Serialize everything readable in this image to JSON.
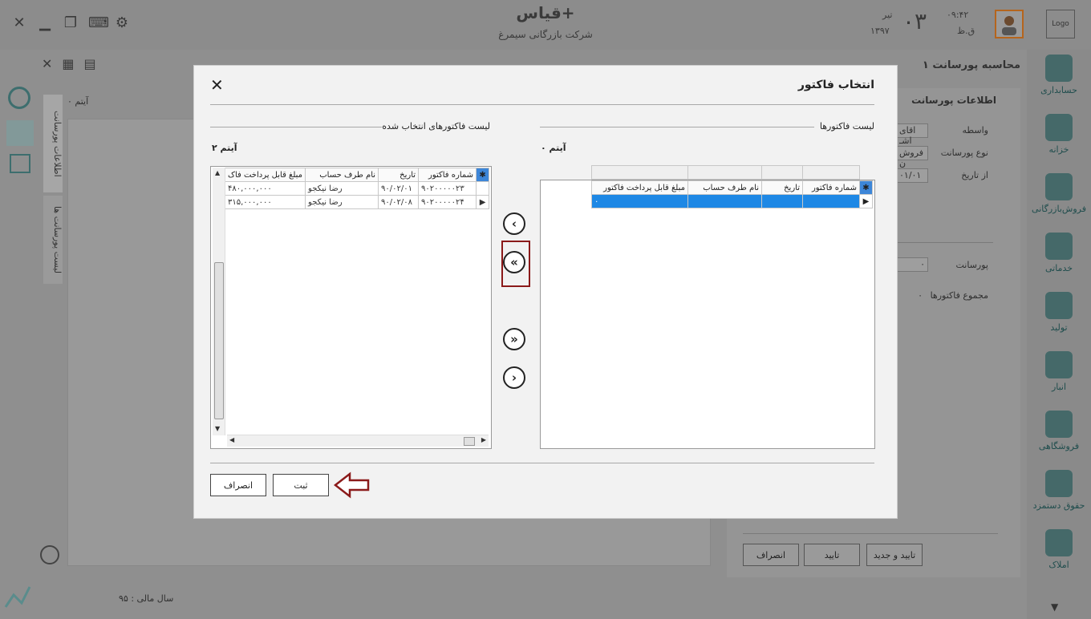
{
  "app": {
    "title": "قیاس+",
    "company": "شرکت بازرگانی سیمرغ",
    "date_day": "۰۳",
    "date_month": "تیر",
    "date_year": "۱۳۹۷",
    "time": "۰۹:۴۲",
    "ampm": "ق.ظ",
    "logo": "Logo",
    "page_title": "محاسبه پورسانت ۱"
  },
  "sidebar": {
    "items": [
      {
        "label": "حسابداری",
        "icon": "accounting-icon"
      },
      {
        "label": "خزانه",
        "icon": "treasury-icon"
      },
      {
        "label": "فروش‌بازرگانی",
        "icon": "globe-sales-icon"
      },
      {
        "label": "خدماتی",
        "icon": "gear-service-icon"
      },
      {
        "label": "تولید",
        "icon": "production-icon"
      },
      {
        "label": "انبار",
        "icon": "warehouse-icon"
      },
      {
        "label": "فروشگاهی",
        "icon": "store-icon"
      },
      {
        "label": "حقوق دستمزد",
        "icon": "coins-icon"
      },
      {
        "label": "املاک",
        "icon": "house-icon"
      }
    ]
  },
  "left_tabs": {
    "tab1": "اطلاعات پورسانت",
    "tab2": "لیست پورسانت ها"
  },
  "background": {
    "items_count": "۰ آیتم",
    "section_title": "اطلاعات پورسانت",
    "agent_label": "واسطه",
    "agent_value": "اقای اشـ",
    "type_label": "نوع پورسانت",
    "type_value": "فروش ن",
    "from_date_label": "از تاریخ",
    "from_date_value": "۰۱/۰۱",
    "commission_label": "پورسانت",
    "commission_value": "۰",
    "invoices_total_label": "مجموع فاکتورها",
    "invoices_total_value": "۰",
    "buttons": {
      "approve_new": "تایید و جدید",
      "approve": "تایید",
      "cancel": "انصراف"
    },
    "fiscal_year": "سال مالی : ۹۵"
  },
  "modal": {
    "title": "انتخاب فاکتور",
    "invoices_section": "لیست فاکتورها",
    "selected_section": "لیست فاکتورهای انتخاب شده",
    "invoices_count": "۰ آیتم",
    "selected_count": "۲ آیتم",
    "columns": [
      "شماره فاکتور",
      "تاریخ",
      "نام طرف حساب",
      "مبلغ قابل پرداخت فاکتور"
    ],
    "selected_columns": [
      "شماره فاکتور",
      "تاریخ",
      "نام طرف حساب",
      "مبلغ قابل پرداخت فاک"
    ],
    "invoices_new_row_value": "۰",
    "selected_rows": [
      {
        "number": "۹۰۲۰۰۰۰۰۲۳",
        "date": "۹۰/۰۲/۰۱",
        "party": "رضا نیکجو",
        "amount": "۴۸۰,۰۰۰,۰۰۰"
      },
      {
        "number": "۹۰۲۰۰۰۰۰۲۴",
        "date": "۹۰/۰۲/۰۸",
        "party": "رضا نیکجو",
        "amount": "۳۱۵,۰۰۰,۰۰۰"
      }
    ],
    "submit": "ثبت",
    "cancel": "انصراف"
  }
}
